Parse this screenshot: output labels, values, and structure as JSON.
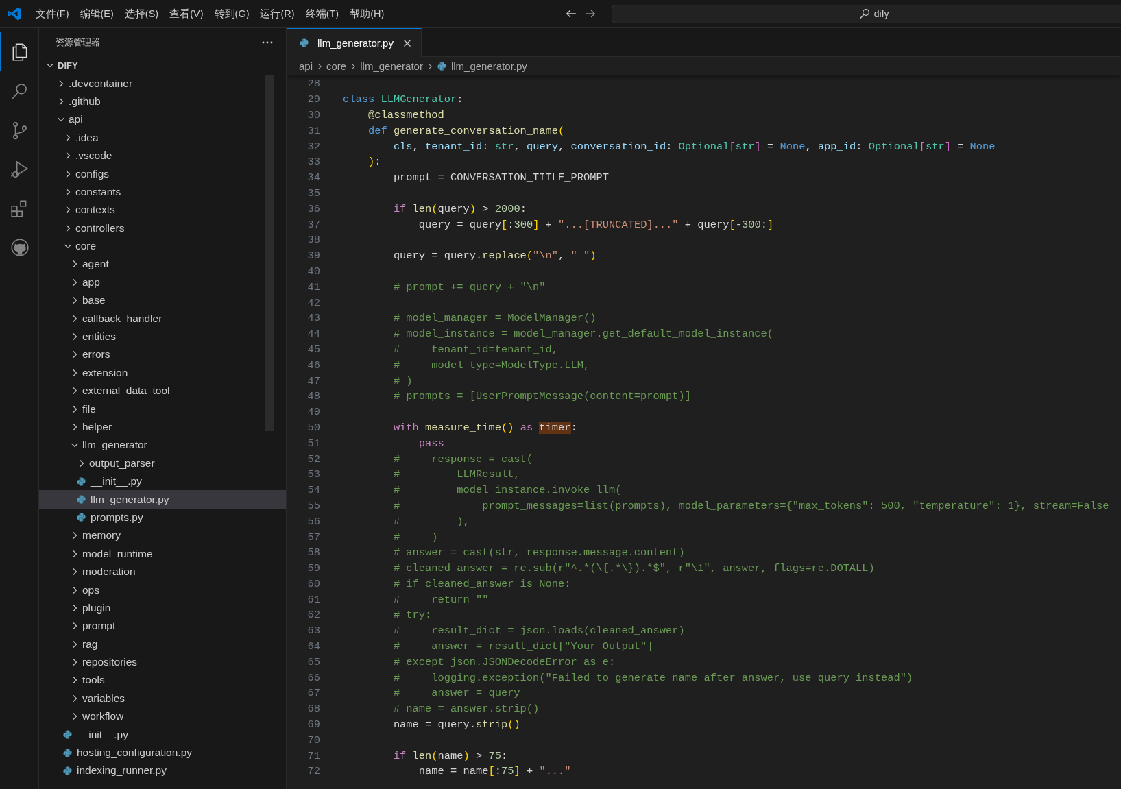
{
  "title_bar": {
    "menu": [
      "文件(F)",
      "编辑(E)",
      "选择(S)",
      "查看(V)",
      "转到(G)",
      "运行(R)",
      "终端(T)",
      "帮助(H)"
    ],
    "search": {
      "value": "dify"
    }
  },
  "activity_bar": [
    {
      "kind": "explorer",
      "selected": true
    },
    {
      "kind": "search",
      "selected": false
    },
    {
      "kind": "source-control",
      "selected": false
    },
    {
      "kind": "run-debug",
      "selected": false
    },
    {
      "kind": "extensions",
      "selected": false
    },
    {
      "kind": "github",
      "selected": false
    }
  ],
  "explorer": {
    "title": "资源管理器",
    "tree": {
      "label": "DIFY",
      "kind": "folder",
      "expanded": true,
      "selected": false,
      "children": [
        {
          "label": ".devcontainer",
          "kind": "folder",
          "expanded": false,
          "selected": false
        },
        {
          "label": ".github",
          "kind": "folder",
          "expanded": false,
          "selected": false
        },
        {
          "label": "api",
          "kind": "folder",
          "expanded": true,
          "selected": false,
          "children": [
            {
              "label": ".idea",
              "kind": "folder",
              "expanded": false,
              "selected": false
            },
            {
              "label": ".vscode",
              "kind": "folder",
              "expanded": false,
              "selected": false
            },
            {
              "label": "configs",
              "kind": "folder",
              "expanded": false,
              "selected": false
            },
            {
              "label": "constants",
              "kind": "folder",
              "expanded": false,
              "selected": false
            },
            {
              "label": "contexts",
              "kind": "folder",
              "expanded": false,
              "selected": false
            },
            {
              "label": "controllers",
              "kind": "folder",
              "expanded": false,
              "selected": false
            },
            {
              "label": "core",
              "kind": "folder",
              "expanded": true,
              "selected": false,
              "children": [
                {
                  "label": "agent",
                  "kind": "folder",
                  "expanded": false,
                  "selected": false
                },
                {
                  "label": "app",
                  "kind": "folder",
                  "expanded": false,
                  "selected": false
                },
                {
                  "label": "base",
                  "kind": "folder",
                  "expanded": false,
                  "selected": false
                },
                {
                  "label": "callback_handler",
                  "kind": "folder",
                  "expanded": false,
                  "selected": false
                },
                {
                  "label": "entities",
                  "kind": "folder",
                  "expanded": false,
                  "selected": false
                },
                {
                  "label": "errors",
                  "kind": "folder",
                  "expanded": false,
                  "selected": false
                },
                {
                  "label": "extension",
                  "kind": "folder",
                  "expanded": false,
                  "selected": false
                },
                {
                  "label": "external_data_tool",
                  "kind": "folder",
                  "expanded": false,
                  "selected": false
                },
                {
                  "label": "file",
                  "kind": "folder",
                  "expanded": false,
                  "selected": false
                },
                {
                  "label": "helper",
                  "kind": "folder",
                  "expanded": false,
                  "selected": false
                },
                {
                  "label": "llm_generator",
                  "kind": "folder",
                  "expanded": true,
                  "selected": false,
                  "children": [
                    {
                      "label": "output_parser",
                      "kind": "folder",
                      "expanded": false,
                      "selected": false
                    },
                    {
                      "label": "__init__.py",
                      "kind": "file",
                      "selected": false
                    },
                    {
                      "label": "llm_generator.py",
                      "kind": "file",
                      "selected": true
                    },
                    {
                      "label": "prompts.py",
                      "kind": "file",
                      "selected": false
                    }
                  ]
                },
                {
                  "label": "memory",
                  "kind": "folder",
                  "expanded": false,
                  "selected": false
                },
                {
                  "label": "model_runtime",
                  "kind": "folder",
                  "expanded": false,
                  "selected": false
                },
                {
                  "label": "moderation",
                  "kind": "folder",
                  "expanded": false,
                  "selected": false
                },
                {
                  "label": "ops",
                  "kind": "folder",
                  "expanded": false,
                  "selected": false
                },
                {
                  "label": "plugin",
                  "kind": "folder",
                  "expanded": false,
                  "selected": false
                },
                {
                  "label": "prompt",
                  "kind": "folder",
                  "expanded": false,
                  "selected": false
                },
                {
                  "label": "rag",
                  "kind": "folder",
                  "expanded": false,
                  "selected": false
                },
                {
                  "label": "repositories",
                  "kind": "folder",
                  "expanded": false,
                  "selected": false
                },
                {
                  "label": "tools",
                  "kind": "folder",
                  "expanded": false,
                  "selected": false
                },
                {
                  "label": "variables",
                  "kind": "folder",
                  "expanded": false,
                  "selected": false
                },
                {
                  "label": "workflow",
                  "kind": "folder",
                  "expanded": false,
                  "selected": false
                }
              ]
            },
            {
              "label": "__init__.py",
              "kind": "file",
              "selected": false
            },
            {
              "label": "hosting_configuration.py",
              "kind": "file",
              "selected": false
            },
            {
              "label": "indexing_runner.py",
              "kind": "file",
              "selected": false
            }
          ]
        }
      ]
    }
  },
  "tabs": [
    {
      "label": "llm_generator.py",
      "selected": true
    }
  ],
  "breadcrumb": [
    {
      "label": "api",
      "kind": "folder"
    },
    {
      "label": "core",
      "kind": "folder"
    },
    {
      "label": "llm_generator",
      "kind": "folder"
    },
    {
      "label": "llm_generator.py",
      "kind": "file"
    }
  ],
  "editor": {
    "lines": [
      {
        "number": "28"
      },
      {
        "number": "29",
        "tokens": [
          {
            "kind": "kw",
            "text": "class "
          },
          {
            "kind": "cls",
            "text": "LLMGenerator"
          },
          {
            "kind": "p",
            "text": ":"
          }
        ]
      },
      {
        "number": "30",
        "tokens": [
          {
            "kind": "fn",
            "text": "    @classmethod"
          }
        ]
      },
      {
        "number": "31",
        "tokens": [
          {
            "kind": "kw",
            "text": "    def "
          },
          {
            "kind": "fn",
            "text": "generate_conversation_name"
          },
          {
            "kind": "b1",
            "text": "("
          }
        ]
      },
      {
        "number": "32",
        "tokens": [
          {
            "kind": "var",
            "text": "        cls"
          },
          {
            "kind": "p",
            "text": ", "
          },
          {
            "kind": "var",
            "text": "tenant_id"
          },
          {
            "kind": "p",
            "text": ": "
          },
          {
            "kind": "cls",
            "text": "str"
          },
          {
            "kind": "p",
            "text": ", "
          },
          {
            "kind": "var",
            "text": "query"
          },
          {
            "kind": "p",
            "text": ", "
          },
          {
            "kind": "var",
            "text": "conversation_id"
          },
          {
            "kind": "p",
            "text": ": "
          },
          {
            "kind": "cls",
            "text": "Optional"
          },
          {
            "kind": "b2",
            "text": "["
          },
          {
            "kind": "cls",
            "text": "str"
          },
          {
            "kind": "b2",
            "text": "]"
          },
          {
            "kind": "p",
            "text": " = "
          },
          {
            "kind": "kw",
            "text": "None"
          },
          {
            "kind": "p",
            "text": ", "
          },
          {
            "kind": "var",
            "text": "app_id"
          },
          {
            "kind": "p",
            "text": ": "
          },
          {
            "kind": "cls",
            "text": "Optional"
          },
          {
            "kind": "b2",
            "text": "["
          },
          {
            "kind": "cls",
            "text": "str"
          },
          {
            "kind": "b2",
            "text": "]"
          },
          {
            "kind": "p",
            "text": " = "
          },
          {
            "kind": "kw",
            "text": "None"
          }
        ]
      },
      {
        "number": "33",
        "tokens": [
          {
            "kind": "b1",
            "text": "    )"
          },
          {
            "kind": "p",
            "text": ":"
          }
        ]
      },
      {
        "number": "34",
        "tokens": [
          {
            "kind": "p",
            "text": "        prompt = CONVERSATION_TITLE_PROMPT"
          }
        ]
      },
      {
        "number": "35"
      },
      {
        "number": "36",
        "tokens": [
          {
            "kind": "ctrl",
            "text": "        if "
          },
          {
            "kind": "fn",
            "text": "len"
          },
          {
            "kind": "b1",
            "text": "("
          },
          {
            "kind": "p",
            "text": "query"
          },
          {
            "kind": "b1",
            "text": ")"
          },
          {
            "kind": "p",
            "text": " > "
          },
          {
            "kind": "num",
            "text": "2000"
          },
          {
            "kind": "p",
            "text": ":"
          }
        ]
      },
      {
        "number": "37",
        "tokens": [
          {
            "kind": "p",
            "text": "            query = query"
          },
          {
            "kind": "b1",
            "text": "["
          },
          {
            "kind": "p",
            "text": ":"
          },
          {
            "kind": "num",
            "text": "300"
          },
          {
            "kind": "b1",
            "text": "]"
          },
          {
            "kind": "p",
            "text": " + "
          },
          {
            "kind": "str",
            "text": "\"...[TRUNCATED]...\""
          },
          {
            "kind": "p",
            "text": " + query"
          },
          {
            "kind": "b1",
            "text": "["
          },
          {
            "kind": "p",
            "text": "-"
          },
          {
            "kind": "num",
            "text": "300"
          },
          {
            "kind": "p",
            "text": ":"
          },
          {
            "kind": "b1",
            "text": "]"
          }
        ]
      },
      {
        "number": "38"
      },
      {
        "number": "39",
        "tokens": [
          {
            "kind": "p",
            "text": "        query = query."
          },
          {
            "kind": "fn",
            "text": "replace"
          },
          {
            "kind": "b1",
            "text": "("
          },
          {
            "kind": "str",
            "text": "\"\\n\""
          },
          {
            "kind": "p",
            "text": ", "
          },
          {
            "kind": "str",
            "text": "\" \""
          },
          {
            "kind": "b1",
            "text": ")"
          }
        ]
      },
      {
        "number": "40"
      },
      {
        "number": "41",
        "tokens": [
          {
            "kind": "com",
            "text": "        # prompt += query + \"\\n\""
          }
        ]
      },
      {
        "number": "42"
      },
      {
        "number": "43",
        "tokens": [
          {
            "kind": "com",
            "text": "        # model_manager = ModelManager()"
          }
        ]
      },
      {
        "number": "44",
        "tokens": [
          {
            "kind": "com",
            "text": "        # model_instance = model_manager.get_default_model_instance("
          }
        ]
      },
      {
        "number": "45",
        "tokens": [
          {
            "kind": "com",
            "text": "        #     tenant_id=tenant_id,"
          }
        ]
      },
      {
        "number": "46",
        "tokens": [
          {
            "kind": "com",
            "text": "        #     model_type=ModelType.LLM,"
          }
        ]
      },
      {
        "number": "47",
        "tokens": [
          {
            "kind": "com",
            "text": "        # )"
          }
        ]
      },
      {
        "number": "48",
        "tokens": [
          {
            "kind": "com",
            "text": "        # prompts = [UserPromptMessage(content=prompt)]"
          }
        ]
      },
      {
        "number": "49"
      },
      {
        "number": "50",
        "tokens": [
          {
            "kind": "ctrl",
            "text": "        with "
          },
          {
            "kind": "fn",
            "text": "measure_time"
          },
          {
            "kind": "b1",
            "text": "()"
          },
          {
            "kind": "ctrl",
            "text": " as "
          },
          {
            "kind": "hl",
            "text": "timer"
          },
          {
            "kind": "p",
            "text": ":"
          }
        ]
      },
      {
        "number": "51",
        "tokens": [
          {
            "kind": "ctrl",
            "text": "            pass"
          }
        ]
      },
      {
        "number": "52",
        "tokens": [
          {
            "kind": "com",
            "text": "        #     response = cast("
          }
        ]
      },
      {
        "number": "53",
        "tokens": [
          {
            "kind": "com",
            "text": "        #         LLMResult,"
          }
        ]
      },
      {
        "number": "54",
        "tokens": [
          {
            "kind": "com",
            "text": "        #         model_instance.invoke_llm("
          }
        ]
      },
      {
        "number": "55",
        "tokens": [
          {
            "kind": "com",
            "text": "        #             prompt_messages=list(prompts), model_parameters={\"max_tokens\": 500, \"temperature\": 1}, stream=False"
          }
        ]
      },
      {
        "number": "56",
        "tokens": [
          {
            "kind": "com",
            "text": "        #         ),"
          }
        ]
      },
      {
        "number": "57",
        "tokens": [
          {
            "kind": "com",
            "text": "        #     )"
          }
        ]
      },
      {
        "number": "58",
        "tokens": [
          {
            "kind": "com",
            "text": "        # answer = cast(str, response.message.content)"
          }
        ]
      },
      {
        "number": "59",
        "tokens": [
          {
            "kind": "com",
            "text": "        # cleaned_answer = re.sub(r\"^.*(\\{.*\\}).*$\", r\"\\1\", answer, flags=re.DOTALL)"
          }
        ]
      },
      {
        "number": "60",
        "tokens": [
          {
            "kind": "com",
            "text": "        # if cleaned_answer is None:"
          }
        ]
      },
      {
        "number": "61",
        "tokens": [
          {
            "kind": "com",
            "text": "        #     return \"\""
          }
        ]
      },
      {
        "number": "62",
        "tokens": [
          {
            "kind": "com",
            "text": "        # try:"
          }
        ]
      },
      {
        "number": "63",
        "tokens": [
          {
            "kind": "com",
            "text": "        #     result_dict = json.loads(cleaned_answer)"
          }
        ]
      },
      {
        "number": "64",
        "tokens": [
          {
            "kind": "com",
            "text": "        #     answer = result_dict[\"Your Output\"]"
          }
        ]
      },
      {
        "number": "65",
        "tokens": [
          {
            "kind": "com",
            "text": "        # except json.JSONDecodeError as e:"
          }
        ]
      },
      {
        "number": "66",
        "tokens": [
          {
            "kind": "com",
            "text": "        #     logging.exception(\"Failed to generate name after answer, use query instead\")"
          }
        ]
      },
      {
        "number": "67",
        "tokens": [
          {
            "kind": "com",
            "text": "        #     answer = query"
          }
        ]
      },
      {
        "number": "68",
        "tokens": [
          {
            "kind": "com",
            "text": "        # name = answer.strip()"
          }
        ]
      },
      {
        "number": "69",
        "tokens": [
          {
            "kind": "p",
            "text": "        name = query."
          },
          {
            "kind": "fn",
            "text": "strip"
          },
          {
            "kind": "b1",
            "text": "()"
          }
        ]
      },
      {
        "number": "70"
      },
      {
        "number": "71",
        "tokens": [
          {
            "kind": "ctrl",
            "text": "        if "
          },
          {
            "kind": "fn",
            "text": "len"
          },
          {
            "kind": "b1",
            "text": "("
          },
          {
            "kind": "p",
            "text": "name"
          },
          {
            "kind": "b1",
            "text": ")"
          },
          {
            "kind": "p",
            "text": " > "
          },
          {
            "kind": "num",
            "text": "75"
          },
          {
            "kind": "p",
            "text": ":"
          }
        ]
      },
      {
        "number": "72",
        "tokens": [
          {
            "kind": "p",
            "text": "            name = name"
          },
          {
            "kind": "b1",
            "text": "["
          },
          {
            "kind": "p",
            "text": ":"
          },
          {
            "kind": "num",
            "text": "75"
          },
          {
            "kind": "b1",
            "text": "]"
          },
          {
            "kind": "p",
            "text": " + "
          },
          {
            "kind": "str",
            "text": "\"...\""
          }
        ]
      }
    ]
  }
}
